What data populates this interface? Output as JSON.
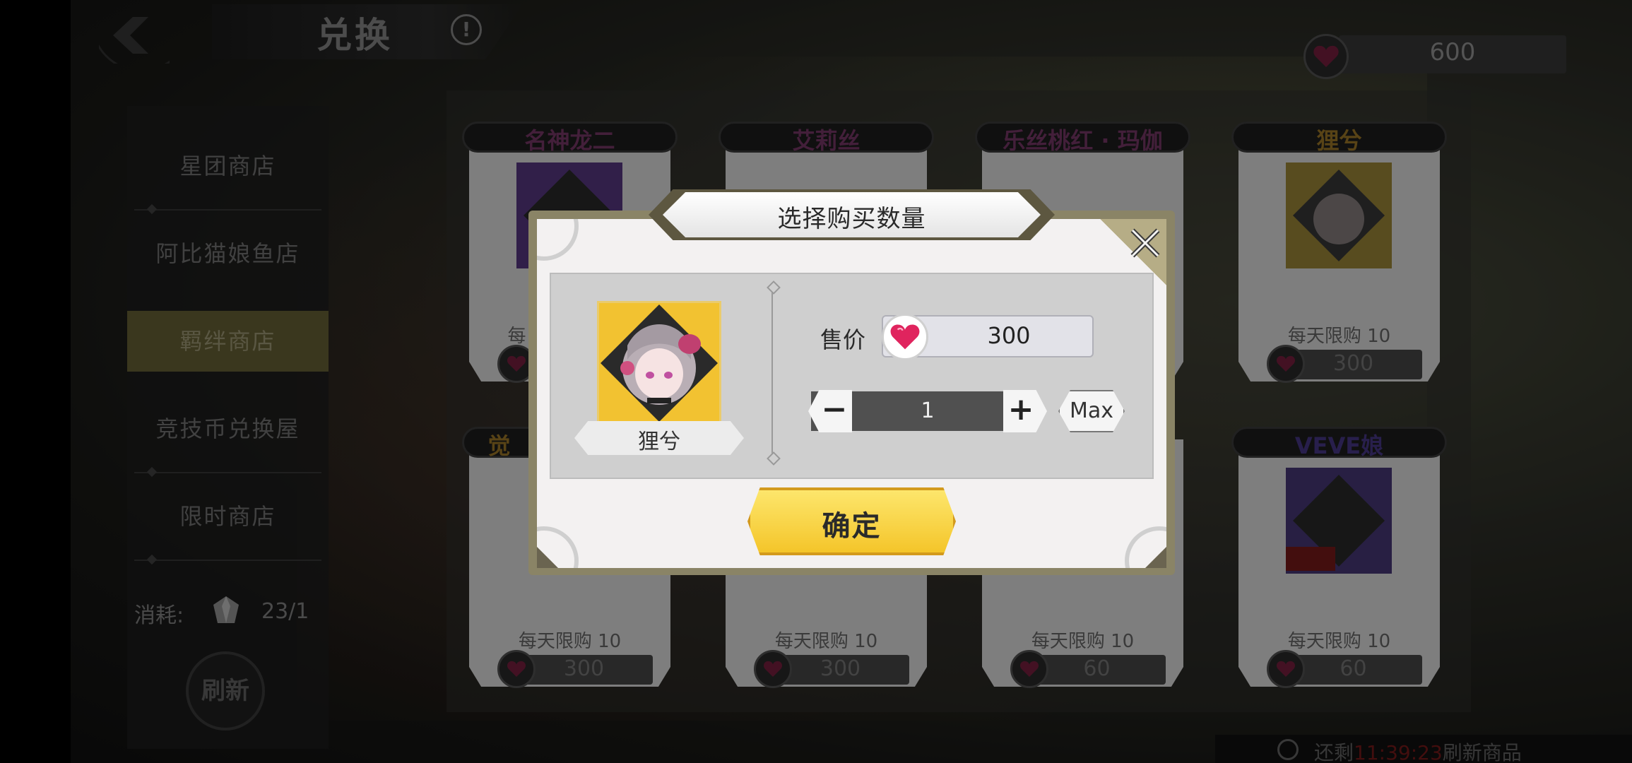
{
  "header": {
    "title": "兑换",
    "currency_value": "600"
  },
  "sidebar": {
    "items": [
      {
        "label": "星团商店"
      },
      {
        "label": "阿比猫娘鱼店"
      },
      {
        "label": "羁绊商店"
      },
      {
        "label": "竞技币兑换屋"
      },
      {
        "label": "限时商店"
      }
    ],
    "active_index": 2,
    "cost_label": "消耗:",
    "cost_value": "23/1",
    "refresh_label": "刷新"
  },
  "shop": {
    "cards": [
      {
        "name": "名神龙二",
        "limit": "",
        "price": ""
      },
      {
        "name": "艾莉丝",
        "limit": "",
        "price": ""
      },
      {
        "name": "乐丝桃红 · 玛伽",
        "limit": "",
        "price": ""
      },
      {
        "name": "狸兮",
        "limit": "每天限购 10",
        "price": "300"
      },
      {
        "name": "觉",
        "limit": "每天限购 10",
        "price": "300"
      },
      {
        "name": "",
        "limit": "每天限购 10",
        "price": "300"
      },
      {
        "name": "",
        "limit": "每天限购 10",
        "price": "60"
      },
      {
        "name": "VEVE娘",
        "limit": "每天限购 10",
        "price": "60"
      }
    ],
    "partial_limit": "每"
  },
  "timer": {
    "prefix": "还剩",
    "countdown": "11:39:23",
    "suffix": "刷新商品"
  },
  "modal": {
    "title": "选择购买数量",
    "item_name": "狸兮",
    "price_label": "售价",
    "price_value": "300",
    "quantity": "1",
    "minus_label": "−",
    "plus_label": "+",
    "max_label": "Max",
    "confirm_label": "确定"
  },
  "colors": {
    "accent_gold": "#f4c52a",
    "heart_pink": "#e0245e",
    "active_nav": "#6b6437"
  }
}
